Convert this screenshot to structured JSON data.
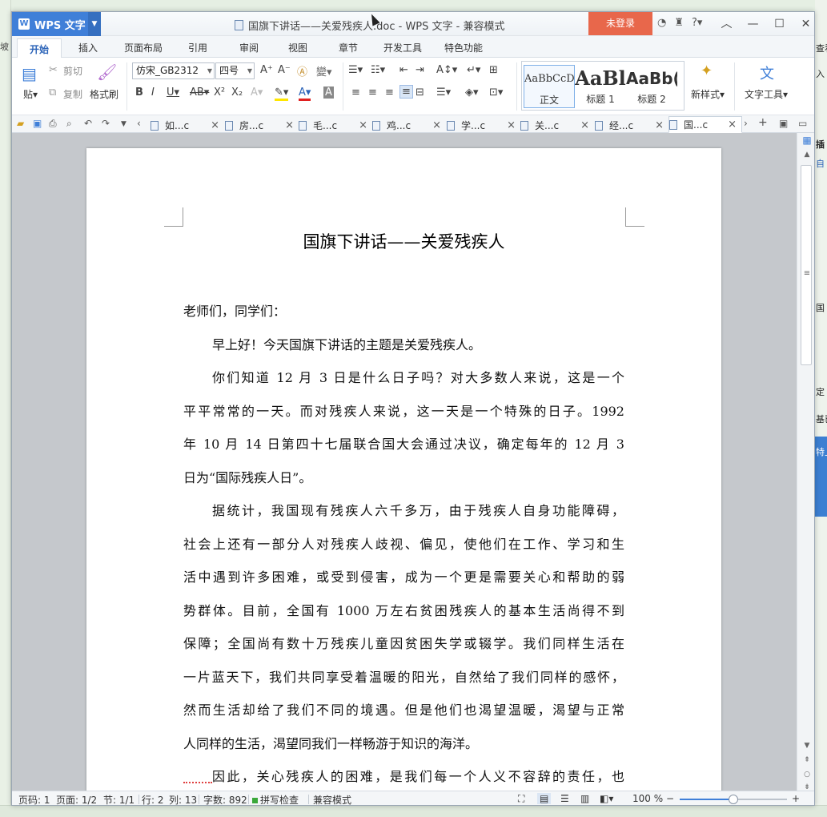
{
  "background": {
    "left_text": "坡",
    "right_texts": [
      {
        "id": "rt1",
        "text": "查看"
      },
      {
        "id": "rt2",
        "text": "入"
      },
      {
        "id": "rt3",
        "text": "插"
      },
      {
        "id": "rt4",
        "text": "自"
      },
      {
        "id": "rt5",
        "text": "国"
      },
      {
        "id": "rt6",
        "text": "定"
      },
      {
        "id": "rt7",
        "text": "基已"
      },
      {
        "id": "rt8",
        "text": "特上"
      }
    ]
  },
  "titlebar": {
    "app_name": "WPS 文字",
    "logo_letter": "W",
    "document_title": "国旗下讲话——关爱残疾人.doc - WPS 文字 - 兼容模式",
    "login_label": "未登录",
    "help_label": "?"
  },
  "menu_tabs": [
    "开始",
    "插入",
    "页面布局",
    "引用",
    "审阅",
    "视图",
    "章节",
    "开发工具",
    "特色功能"
  ],
  "ribbon": {
    "paste_label": "贴",
    "cut_label": "剪切",
    "copy_label": "复制",
    "format_painter_label": "格式刷",
    "font_name": "仿宋_GB2312",
    "font_size": "四号",
    "styles": [
      {
        "preview": "AaBbCcD",
        "label": "正文"
      },
      {
        "preview": "AaBl",
        "label": "标题 1"
      },
      {
        "preview": "AaBb(",
        "label": "标题 2"
      }
    ],
    "new_style_label": "新样式",
    "text_tools_label": "文字工具"
  },
  "doc_tabs": [
    "如...c",
    "房...c",
    "毛...c",
    "鸡...c",
    "学...c",
    "关...c",
    "经...c",
    "国...c"
  ],
  "document": {
    "title": "国旗下讲话——关爱残疾人",
    "lines": [
      {
        "text": "老师们，同学们：",
        "indent": false,
        "just": false
      },
      {
        "text": "早上好！今天国旗下讲话的主题是关爱残疾人。",
        "indent": true,
        "just": false
      },
      {
        "text": "你们知道 12 月 3 日是什么日子吗？对大多数人来说，这是一个",
        "indent": true,
        "just": true
      },
      {
        "text": "平平常常的一天。而对残疾人来说，这一天是一个特殊的日子。1992",
        "indent": false,
        "just": true
      },
      {
        "text": "年 10 月 14 日第四十七届联合国大会通过决议，确定每年的 12 月 3",
        "indent": false,
        "just": true
      },
      {
        "text": "日为“国际残疾人日”。",
        "indent": false,
        "just": false
      },
      {
        "text": "据统计，我国现有残疾人六千多万，由于残疾人自身功能障碍，",
        "indent": true,
        "just": true
      },
      {
        "text": "社会上还有一部分人对残疾人歧视、偏见，使他们在工作、学习和生",
        "indent": false,
        "just": true
      },
      {
        "text": "活中遇到许多困难，或受到侵害，成为一个更是需要关心和帮助的弱",
        "indent": false,
        "just": true
      },
      {
        "text": "势群体。目前，全国有 1000 万左右贫困残疾人的基本生活尚得不到",
        "indent": false,
        "just": true
      },
      {
        "text": "保障；全国尚有数十万残疾儿童因贫困失学或辍学。我们同样生活在",
        "indent": false,
        "just": true
      },
      {
        "text": "一片蓝天下，我们共同享受着温暖的阳光，自然给了我们同样的感怀，",
        "indent": false,
        "just": true
      },
      {
        "text": "然而生活却给了我们不同的境遇。但是他们也渴望温暖，渴望与正常",
        "indent": false,
        "just": true
      },
      {
        "text": "人同样的生活，渴望同我们一样畅游于知识的海洋。",
        "indent": false,
        "just": false
      },
      {
        "text": "因此，关心残疾人的困难，是我们每一个人义不容辞的责任，也",
        "indent": true,
        "just": true
      }
    ]
  },
  "statusbar": {
    "page_code": "页码: 1",
    "pages": "页面: 1/2",
    "section": "节: 1/1",
    "row": "行: 2",
    "column": "列: 13",
    "word_count": "字数: 892",
    "spell_check": "拼写检查",
    "compat_mode": "兼容模式",
    "zoom": "100 %",
    "zoom_fraction": 0.5
  }
}
